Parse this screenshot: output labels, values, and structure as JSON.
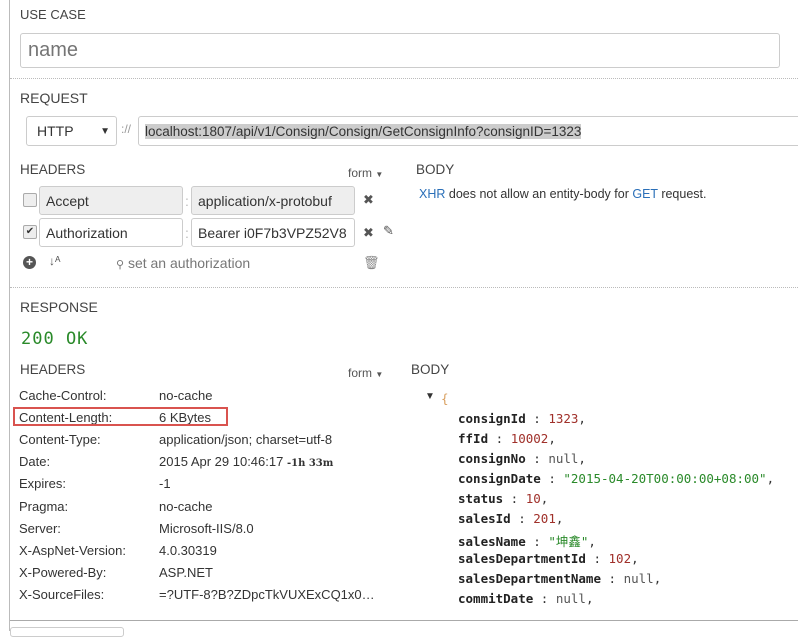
{
  "use_case": {
    "label": "USE CASE",
    "placeholder": "name"
  },
  "request": {
    "label": "REQUEST",
    "protocol": "HTTP",
    "separator": "://",
    "url": "localhost:1807/api/v1/Consign/Consign/GetConsignInfo?consignID=1323",
    "headers_label": "HEADERS",
    "form_label": "form",
    "body_label": "BODY",
    "headers": [
      {
        "checked": false,
        "key": "Accept",
        "value": "application/x-protobuf"
      },
      {
        "checked": true,
        "key": "Authorization",
        "value": "Bearer i0F7b3VPZ52V8"
      }
    ],
    "set_auth": "set an authorization",
    "body_msg": {
      "xhr": "XHR",
      "mid": "does not allow an entity-body for",
      "get": "GET",
      "end": "request."
    }
  },
  "response": {
    "label": "RESPONSE",
    "status": "200 OK",
    "headers_label": "HEADERS",
    "form_label": "form",
    "body_label": "BODY",
    "headers": [
      {
        "k": "Cache-Control:",
        "v": "no-cache"
      },
      {
        "k": "Content-Length:",
        "v": "6 KBytes"
      },
      {
        "k": "Content-Type:",
        "v": "application/json; charset=utf-8"
      },
      {
        "k": "Date:",
        "v": "2015 Apr 29 10:46:17",
        "extra": "-1h 33m"
      },
      {
        "k": "Expires:",
        "v": "-1"
      },
      {
        "k": "Pragma:",
        "v": "no-cache"
      },
      {
        "k": "Server:",
        "v": "Microsoft-IIS/8.0"
      },
      {
        "k": "X-AspNet-Version:",
        "v": "4.0.30319"
      },
      {
        "k": "X-Powered-By:",
        "v": "ASP.NET"
      },
      {
        "k": "X-SourceFiles:",
        "v": "=?UTF-8?B?ZDpcTkVUXExCQ1x0…"
      }
    ],
    "json_open": "{",
    "body": [
      {
        "k": "consignId",
        "v": "1323",
        "t": "num"
      },
      {
        "k": "ffId",
        "v": "10002",
        "t": "num"
      },
      {
        "k": "consignNo",
        "v": "null",
        "t": "nul"
      },
      {
        "k": "consignDate",
        "v": "\"2015-04-20T00:00:00+08:00\"",
        "t": "str"
      },
      {
        "k": "status",
        "v": "10",
        "t": "num"
      },
      {
        "k": "salesId",
        "v": "201",
        "t": "num"
      },
      {
        "k": "salesName",
        "v": "\"坤鑫\"",
        "t": "str"
      },
      {
        "k": "salesDepartmentId",
        "v": "102",
        "t": "num"
      },
      {
        "k": "salesDepartmentName",
        "v": "null",
        "t": "nul"
      },
      {
        "k": "commitDate",
        "v": "null",
        "t": "nul"
      }
    ]
  },
  "colors": {
    "status": "#2a8a2a",
    "link": "#2a6fb8",
    "highlight": "#d9534f"
  }
}
